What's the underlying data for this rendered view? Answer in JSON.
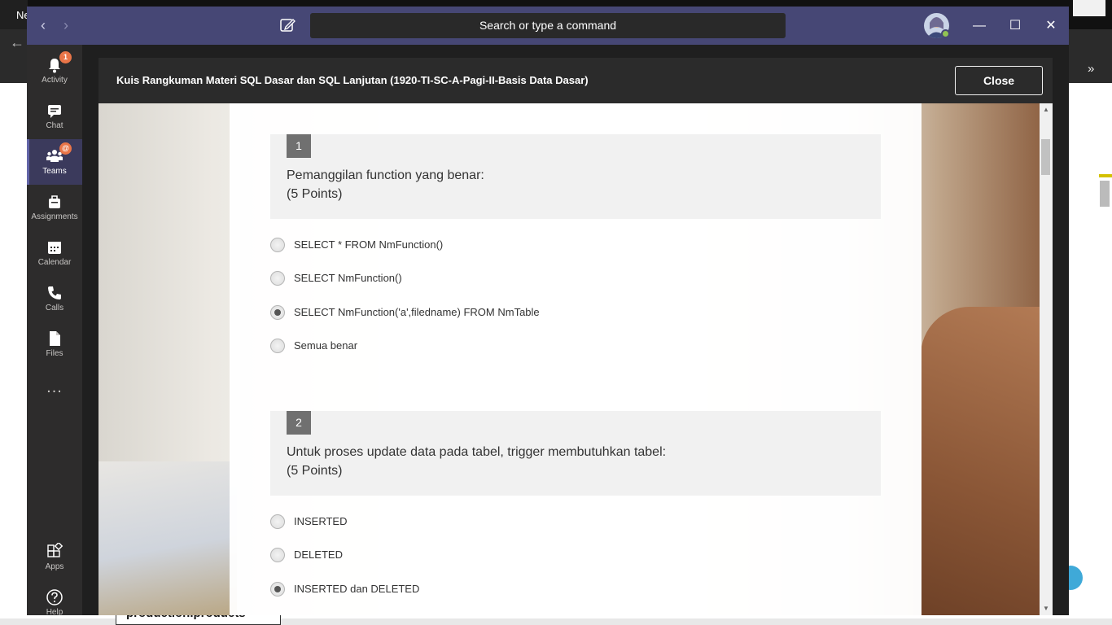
{
  "background": {
    "tab_fragment": "Ne",
    "bottom_text": "production.products"
  },
  "titlebar": {
    "search_placeholder": "Search or type a command"
  },
  "appbar": {
    "items": [
      {
        "label": "Activity",
        "icon": "bell-icon",
        "badge": "1"
      },
      {
        "label": "Chat",
        "icon": "chat-icon"
      },
      {
        "label": "Teams",
        "icon": "teams-icon",
        "badge": "@"
      },
      {
        "label": "Assignments",
        "icon": "assignments-icon"
      },
      {
        "label": "Calendar",
        "icon": "calendar-icon"
      },
      {
        "label": "Calls",
        "icon": "phone-icon"
      },
      {
        "label": "Files",
        "icon": "file-icon"
      },
      {
        "label": "Apps",
        "icon": "apps-icon"
      },
      {
        "label": "Help",
        "icon": "help-icon"
      }
    ],
    "more_label": "..."
  },
  "dialog": {
    "title": "Kuis Rangkuman Materi SQL Dasar dan SQL Lanjutan (1920-TI-SC-A-Pagi-II-Basis Data Dasar)",
    "close_label": "Close"
  },
  "questions": [
    {
      "number": "1",
      "text": "Pemanggilan function yang benar:",
      "points": "(5 Points)",
      "options": [
        {
          "label": "SELECT * FROM NmFunction()",
          "selected": false
        },
        {
          "label": "SELECT NmFunction()",
          "selected": false
        },
        {
          "label": "SELECT NmFunction('a',filedname) FROM NmTable",
          "selected": true
        },
        {
          "label": "Semua benar",
          "selected": false
        }
      ]
    },
    {
      "number": "2",
      "text": "Untuk proses update data pada tabel, trigger membutuhkan tabel:",
      "points": "(5 Points)",
      "options": [
        {
          "label": "INSERTED",
          "selected": false
        },
        {
          "label": "DELETED",
          "selected": false
        },
        {
          "label": "INSERTED dan DELETED",
          "selected": true
        }
      ]
    }
  ],
  "colors": {
    "titlebar": "#464775",
    "appbar": "#2d2c2c",
    "accent": "#6264a7",
    "badge": "#e97548",
    "question_bg": "#f1f1f1"
  }
}
